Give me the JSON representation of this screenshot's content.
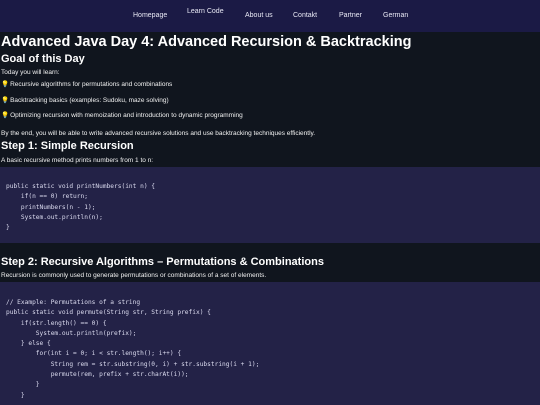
{
  "nav": {
    "items": [
      {
        "label": "Homepage"
      },
      {
        "label": "Learn Code"
      },
      {
        "label": "About us"
      },
      {
        "label": "Contakt"
      },
      {
        "label": "Partner"
      },
      {
        "label": "German"
      }
    ]
  },
  "page": {
    "title": "Advanced Java Day 4: Advanced Recursion & Backtracking",
    "goal": {
      "heading": "Goal of this Day",
      "intro": "Today you will learn:",
      "items": [
        {
          "icon": "lightbulb-icon",
          "text": "Recursive algorithms for permutations and combinations"
        },
        {
          "icon": "lightbulb-icon",
          "text": "Backtracking basics (examples: Sudoku, maze solving)"
        },
        {
          "icon": "lightbulb-icon",
          "text": "Optimizing recursion with memoization and introduction to dynamic programming"
        }
      ],
      "outro": "By the end, you will be able to write advanced recursive solutions and use backtracking techniques efficiently."
    },
    "step1": {
      "heading": "Step 1: Simple Recursion",
      "desc": "A basic recursive method prints numbers from 1 to n:",
      "code": "public static void printNumbers(int n) {\n    if(n == 0) return;\n    printNumbers(n - 1);\n    System.out.println(n);\n}"
    },
    "step2": {
      "heading": "Step 2: Recursive Algorithms – Permutations & Combinations",
      "desc": "Recursion is commonly used to generate permutations or combinations of a set of elements.",
      "code": "// Example: Permutations of a string\npublic static void permute(String str, String prefix) {\n    if(str.length() == 0) {\n        System.out.println(prefix);\n    } else {\n        for(int i = 0; i < str.length(); i++) {\n            String rem = str.substring(0, i) + str.substring(i + 1);\n            permute(rem, prefix + str.charAt(i));\n        }\n    }"
    }
  },
  "colors": {
    "nav_bg": "#1b1a45",
    "page_bg": "#10151e",
    "code_bg": "#232247",
    "bulb": "#f6c945"
  }
}
